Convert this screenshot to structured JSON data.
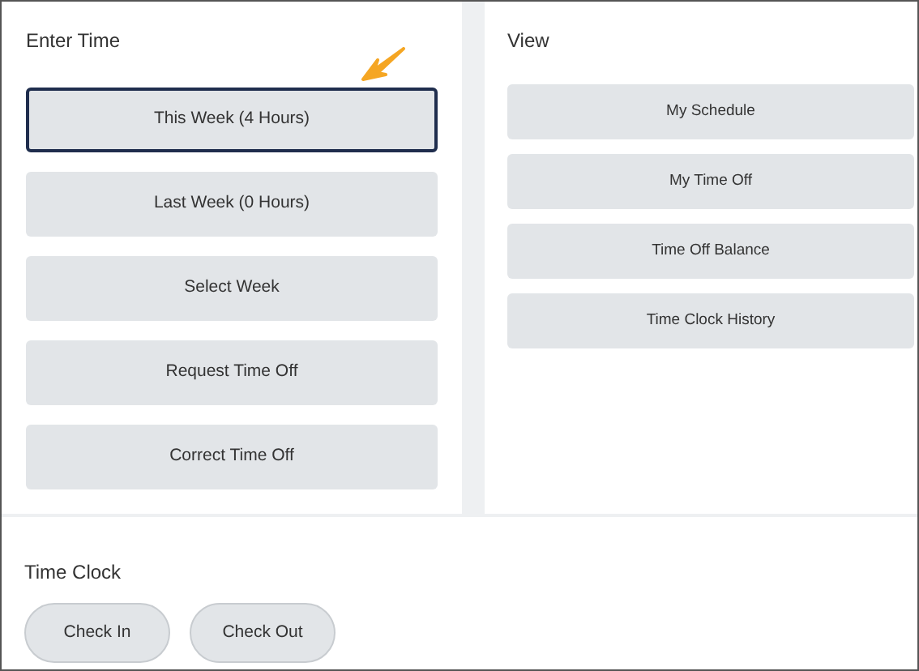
{
  "enter_time": {
    "title": "Enter Time",
    "buttons": [
      {
        "label": "This Week (4 Hours)",
        "selected": true
      },
      {
        "label": "Last Week (0 Hours)",
        "selected": false
      },
      {
        "label": "Select Week",
        "selected": false
      },
      {
        "label": "Request Time Off",
        "selected": false
      },
      {
        "label": "Correct Time Off",
        "selected": false
      }
    ]
  },
  "view": {
    "title": "View",
    "buttons": [
      {
        "label": "My Schedule"
      },
      {
        "label": "My Time Off"
      },
      {
        "label": "Time Off Balance"
      },
      {
        "label": "Time Clock History"
      }
    ]
  },
  "time_clock": {
    "title": "Time Clock",
    "buttons": [
      {
        "label": "Check In"
      },
      {
        "label": "Check Out"
      }
    ]
  }
}
